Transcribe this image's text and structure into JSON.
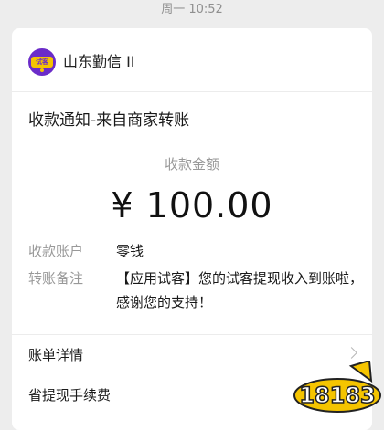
{
  "chat": {
    "timestamp": "周一 10:52"
  },
  "card": {
    "account_name": "山东勤信 II",
    "avatar_text": "试客",
    "title": "收款通知-来自商家转账",
    "amount_label": "收款金额",
    "amount": "¥ 100.00",
    "rows": [
      {
        "label": "收款账户",
        "value": "零钱"
      },
      {
        "label": "转账备注",
        "value": "【应用试客】您的试客提现收入到账啦，感谢您的支持！"
      }
    ],
    "links": [
      {
        "label": "账单详情"
      },
      {
        "label": "省提现手续费"
      }
    ]
  },
  "watermark": {
    "text": "18183"
  },
  "colors": {
    "background": "#ededed",
    "card": "#ffffff",
    "avatar": "#6b2cc9",
    "watermark": "#f5c400"
  }
}
